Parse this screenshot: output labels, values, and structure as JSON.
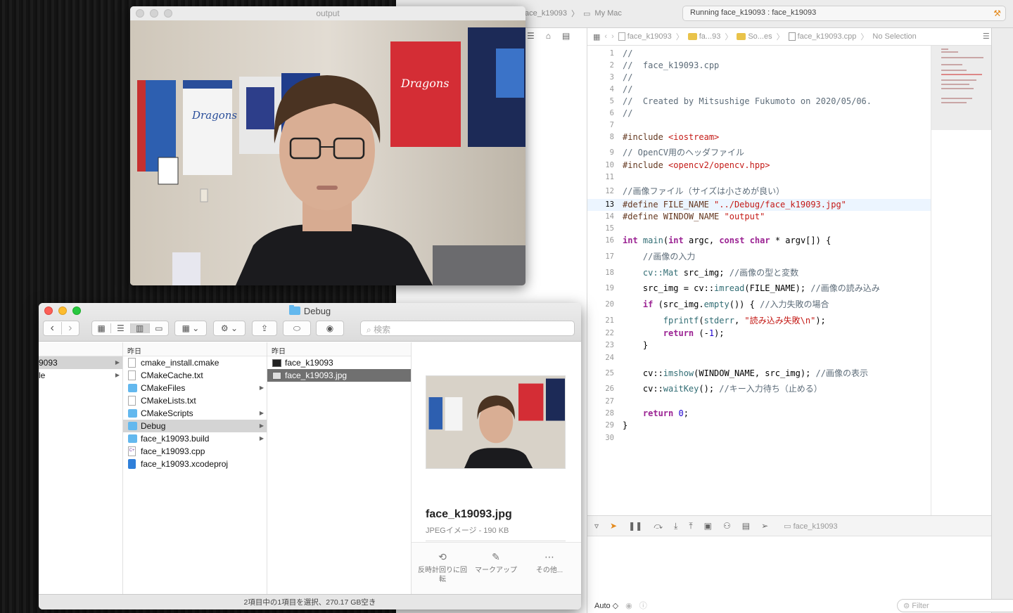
{
  "xcode": {
    "scheme_target": "face_k19093",
    "scheme_device": "My Mac",
    "activity_text": "Running face_k19093 : face_k19093",
    "jumpbar": [
      "face_k19093",
      "fa...93",
      "So...es",
      "face_k19093.cpp",
      "No Selection"
    ],
    "code_lines": [
      {
        "n": "1",
        "t": "//"
      },
      {
        "n": "2",
        "t": "//  face_k19093.cpp"
      },
      {
        "n": "3",
        "t": "//"
      },
      {
        "n": "4",
        "t": "//"
      },
      {
        "n": "5",
        "t": "//  Created by Mitsushige Fukumoto on 2020/05/06."
      },
      {
        "n": "6",
        "t": "//"
      },
      {
        "n": "7",
        "t": ""
      },
      {
        "n": "8",
        "t": "#include <iostream>"
      },
      {
        "n": "9",
        "t": "// OpenCV用のヘッダファイル"
      },
      {
        "n": "10",
        "t": "#include <opencv2/opencv.hpp>"
      },
      {
        "n": "11",
        "t": ""
      },
      {
        "n": "12",
        "t": "//画像ファイル（サイズは小さめが良い）"
      },
      {
        "n": "13",
        "t": "#define FILE_NAME \"../Debug/face_k19093.jpg\""
      },
      {
        "n": "14",
        "t": "#define WINDOW_NAME \"output\""
      },
      {
        "n": "15",
        "t": ""
      },
      {
        "n": "16",
        "t": "int main(int argc, const char * argv[]) {"
      },
      {
        "n": "17",
        "t": "    //画像の入力"
      },
      {
        "n": "18",
        "t": "    cv::Mat src_img; //画像の型と変数"
      },
      {
        "n": "19",
        "t": "    src_img = cv::imread(FILE_NAME); //画像の読み込み"
      },
      {
        "n": "20",
        "t": "    if (src_img.empty()) { //入力失敗の場合"
      },
      {
        "n": "21",
        "t": "        fprintf(stderr, \"読み込み失敗\\n\");"
      },
      {
        "n": "22",
        "t": "        return (-1);"
      },
      {
        "n": "23",
        "t": "    }"
      },
      {
        "n": "24",
        "t": ""
      },
      {
        "n": "25",
        "t": "    cv::imshow(WINDOW_NAME, src_img); //画像の表示"
      },
      {
        "n": "26",
        "t": "    cv::waitKey(); //キー入力待ち（止める）"
      },
      {
        "n": "27",
        "t": ""
      },
      {
        "n": "28",
        "t": "    return 0;"
      },
      {
        "n": "29",
        "t": "}"
      },
      {
        "n": "30",
        "t": ""
      }
    ],
    "current_line": "13",
    "debug_target": "face_k19093",
    "console_mode": "Auto ◇",
    "filter_placeholder": "Filter"
  },
  "output_window": {
    "title": "output"
  },
  "finder": {
    "title": "Debug",
    "search_placeholder": "検索",
    "col1_rows": [
      {
        "label": "9093",
        "arrow": "▶",
        "selected": true
      },
      {
        "label": "le",
        "arrow": "▶",
        "selected": false
      }
    ],
    "col2_header": "昨日",
    "col2_rows": [
      {
        "label": "cmake_install.cmake",
        "icon": "doc",
        "arrow": ""
      },
      {
        "label": "CMakeCache.txt",
        "icon": "doc",
        "arrow": ""
      },
      {
        "label": "CMakeFiles",
        "icon": "folder",
        "arrow": "▶"
      },
      {
        "label": "CMakeLists.txt",
        "icon": "doc",
        "arrow": ""
      },
      {
        "label": "CMakeScripts",
        "icon": "folder",
        "arrow": "▶"
      },
      {
        "label": "Debug",
        "icon": "folder",
        "arrow": "▶"
      },
      {
        "label": "face_k19093.build",
        "icon": "folder",
        "arrow": "▶"
      },
      {
        "label": "face_k19093.cpp",
        "icon": "cpp",
        "arrow": ""
      },
      {
        "label": "face_k19093.xcodeproj",
        "icon": "proj",
        "arrow": ""
      }
    ],
    "col3_header": "昨日",
    "col3_rows": [
      {
        "label": "face_k19093",
        "icon": "exe"
      },
      {
        "label": "face_k19093.jpg",
        "icon": "jpg"
      }
    ],
    "preview": {
      "name": "face_k19093.jpg",
      "kind": "JPEGイメージ - 190 KB",
      "actions": [
        {
          "label": "反時計回りに回転",
          "icon": "⟲"
        },
        {
          "label": "マークアップ",
          "icon": "✎"
        },
        {
          "label": "その他...",
          "icon": "⋯"
        }
      ]
    },
    "status": "2項目中の1項目を選択、270.17 GB空き"
  }
}
